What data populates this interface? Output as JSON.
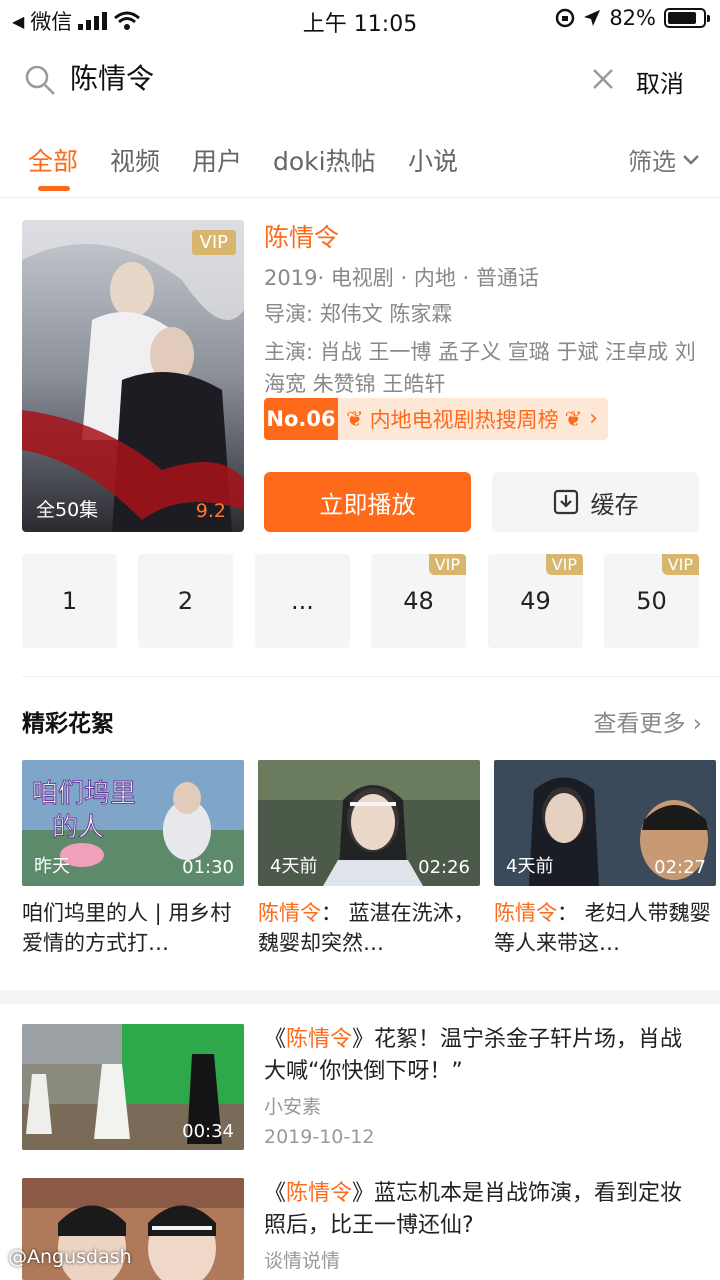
{
  "status_bar": {
    "carrier": "微信",
    "time": "上午 11:05",
    "battery": "82%",
    "battery_level": 0.82
  },
  "search": {
    "query": "陈情令",
    "cancel_label": "取消"
  },
  "tabs": [
    {
      "label": "全部",
      "active": true
    },
    {
      "label": "视频"
    },
    {
      "label": "用户"
    },
    {
      "label": "doki热帖"
    },
    {
      "label": "小说"
    }
  ],
  "filter_label": "筛选",
  "show": {
    "title": "陈情令",
    "vip_badge": "VIP",
    "episode_total": "全50集",
    "score": "9.2",
    "meta": "2019· 电视剧 · 内地 · 普通话",
    "director": "导演:  郑伟文 陈家霖",
    "cast": "主演:  肖战 王一博 孟子义 宣璐 于斌 汪卓成 刘海宽 朱赞锦 王皓轩",
    "rank_no": "No.06",
    "rank_text": "内地电视剧热搜周榜",
    "play_label": "立即播放",
    "cache_label": "缓存"
  },
  "episodes": [
    {
      "label": "1",
      "vip": false
    },
    {
      "label": "2",
      "vip": false
    },
    {
      "label": "...",
      "vip": false
    },
    {
      "label": "48",
      "vip": true
    },
    {
      "label": "49",
      "vip": true
    },
    {
      "label": "50",
      "vip": true
    }
  ],
  "episode_vip_label": "VIP",
  "highlights": {
    "section_title": "精彩花絮",
    "see_more": "查看更多",
    "clips": [
      {
        "ago": "昨天",
        "duration": "01:30",
        "highlight": "",
        "caption": "咱们坞里的人 | 用乡村爱情的方式打…"
      },
      {
        "ago": "4天前",
        "duration": "02:26",
        "highlight": "陈情令",
        "caption": "：  蓝湛在洗沐，魏婴却突然…"
      },
      {
        "ago": "4天前",
        "duration": "02:27",
        "highlight": "陈情令",
        "caption": "：  老妇人带魏婴等人来带这…"
      }
    ]
  },
  "related": [
    {
      "title_pre": "《",
      "title_hl": "陈情令",
      "title_post": "》花絮！温宁杀金子轩片场，肖战大喊“你快倒下呀！”",
      "author": "小安素",
      "date": "2019-10-12",
      "duration": "00:34"
    },
    {
      "title_pre": "《",
      "title_hl": "陈情令",
      "title_post": "》蓝忘机本是肖战饰演，看到定妆照后，比王一博还仙?",
      "author": "谈情说情",
      "date": "",
      "duration": ""
    }
  ],
  "watermark": "@Angusdash",
  "colors": {
    "accent": "#ff6a1a",
    "vip": "#d8b66e"
  }
}
